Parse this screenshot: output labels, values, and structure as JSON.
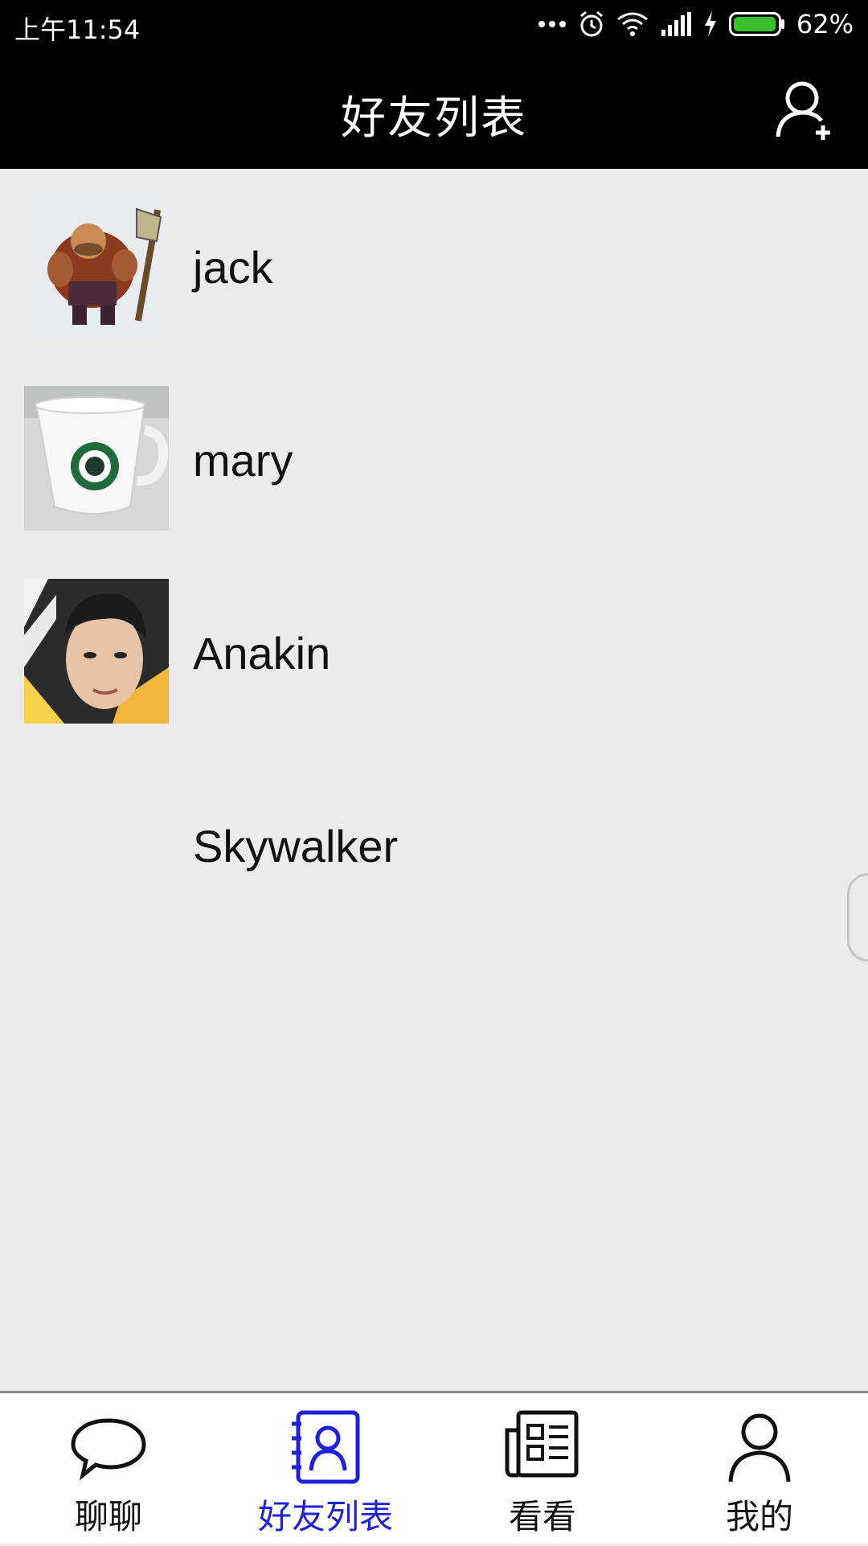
{
  "status_bar": {
    "time": "上午11:54",
    "battery": "62%",
    "battery_color": "#39c02a"
  },
  "header": {
    "title": "好友列表",
    "add_icon": "add-friend-icon"
  },
  "friends": [
    {
      "name": "jack",
      "avatar": "warrior-avatar"
    },
    {
      "name": "mary",
      "avatar": "coffee-cup-avatar"
    },
    {
      "name": "Anakin",
      "avatar": "face-avatar"
    },
    {
      "name": "Skywalker",
      "avatar": "none"
    }
  ],
  "tabs": [
    {
      "label": "聊聊",
      "icon": "chat-bubble-icon",
      "active": false
    },
    {
      "label": "好友列表",
      "icon": "contacts-book-icon",
      "active": true
    },
    {
      "label": "看看",
      "icon": "news-icon",
      "active": false
    },
    {
      "label": "我的",
      "icon": "person-icon",
      "active": false
    }
  ],
  "colors": {
    "header_bg": "#000000",
    "list_bg": "#ebebeb",
    "active_tab": "#1f1fdc"
  }
}
